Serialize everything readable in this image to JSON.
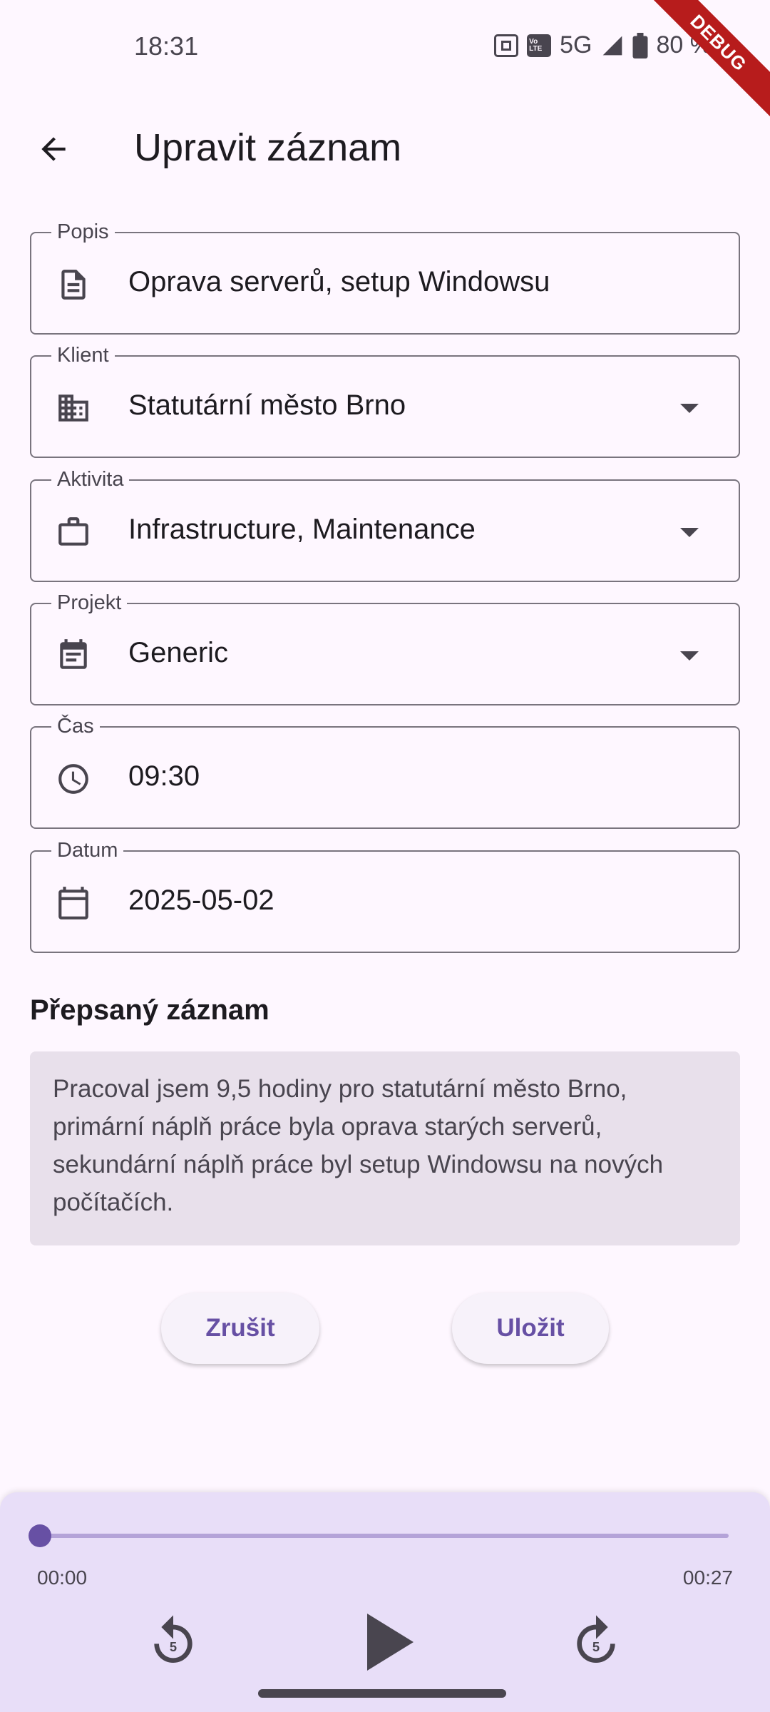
{
  "status_bar": {
    "time": "18:31",
    "network": "5G",
    "battery": "80 %",
    "volte": "Vo LTE"
  },
  "debug_banner": "DEBUG",
  "app_bar": {
    "title": "Upravit záznam",
    "back_icon": "arrow-back-icon"
  },
  "form": {
    "popis": {
      "label": "Popis",
      "value": "Oprava serverů, setup Windowsu",
      "icon": "document-icon"
    },
    "klient": {
      "label": "Klient",
      "value": "Statutární město Brno",
      "icon": "building-icon"
    },
    "aktivita": {
      "label": "Aktivita",
      "value": "Infrastructure, Maintenance",
      "icon": "briefcase-icon"
    },
    "projekt": {
      "label": "Projekt",
      "value": "Generic",
      "icon": "event-note-icon"
    },
    "cas": {
      "label": "Čas",
      "value": "09:30",
      "icon": "clock-icon"
    },
    "datum": {
      "label": "Datum",
      "value": "2025-05-02",
      "icon": "calendar-icon"
    }
  },
  "transcript": {
    "heading": "Přepsaný záznam",
    "text": "Pracoval jsem 9,5 hodiny pro statutární město Brno, primární náplň práce byla oprava starých serverů, sekundární náplň práce byl setup Windowsu na nových počítačích."
  },
  "actions": {
    "cancel_label": "Zrušit",
    "save_label": "Uložit"
  },
  "player": {
    "position": "00:00",
    "duration": "00:27",
    "progress": 0,
    "skip_seconds": "5"
  },
  "colors": {
    "accent": "#6750A4",
    "background": "#FEF7FF",
    "player_background": "#E8DEF8",
    "debug": "#B71C1C"
  }
}
